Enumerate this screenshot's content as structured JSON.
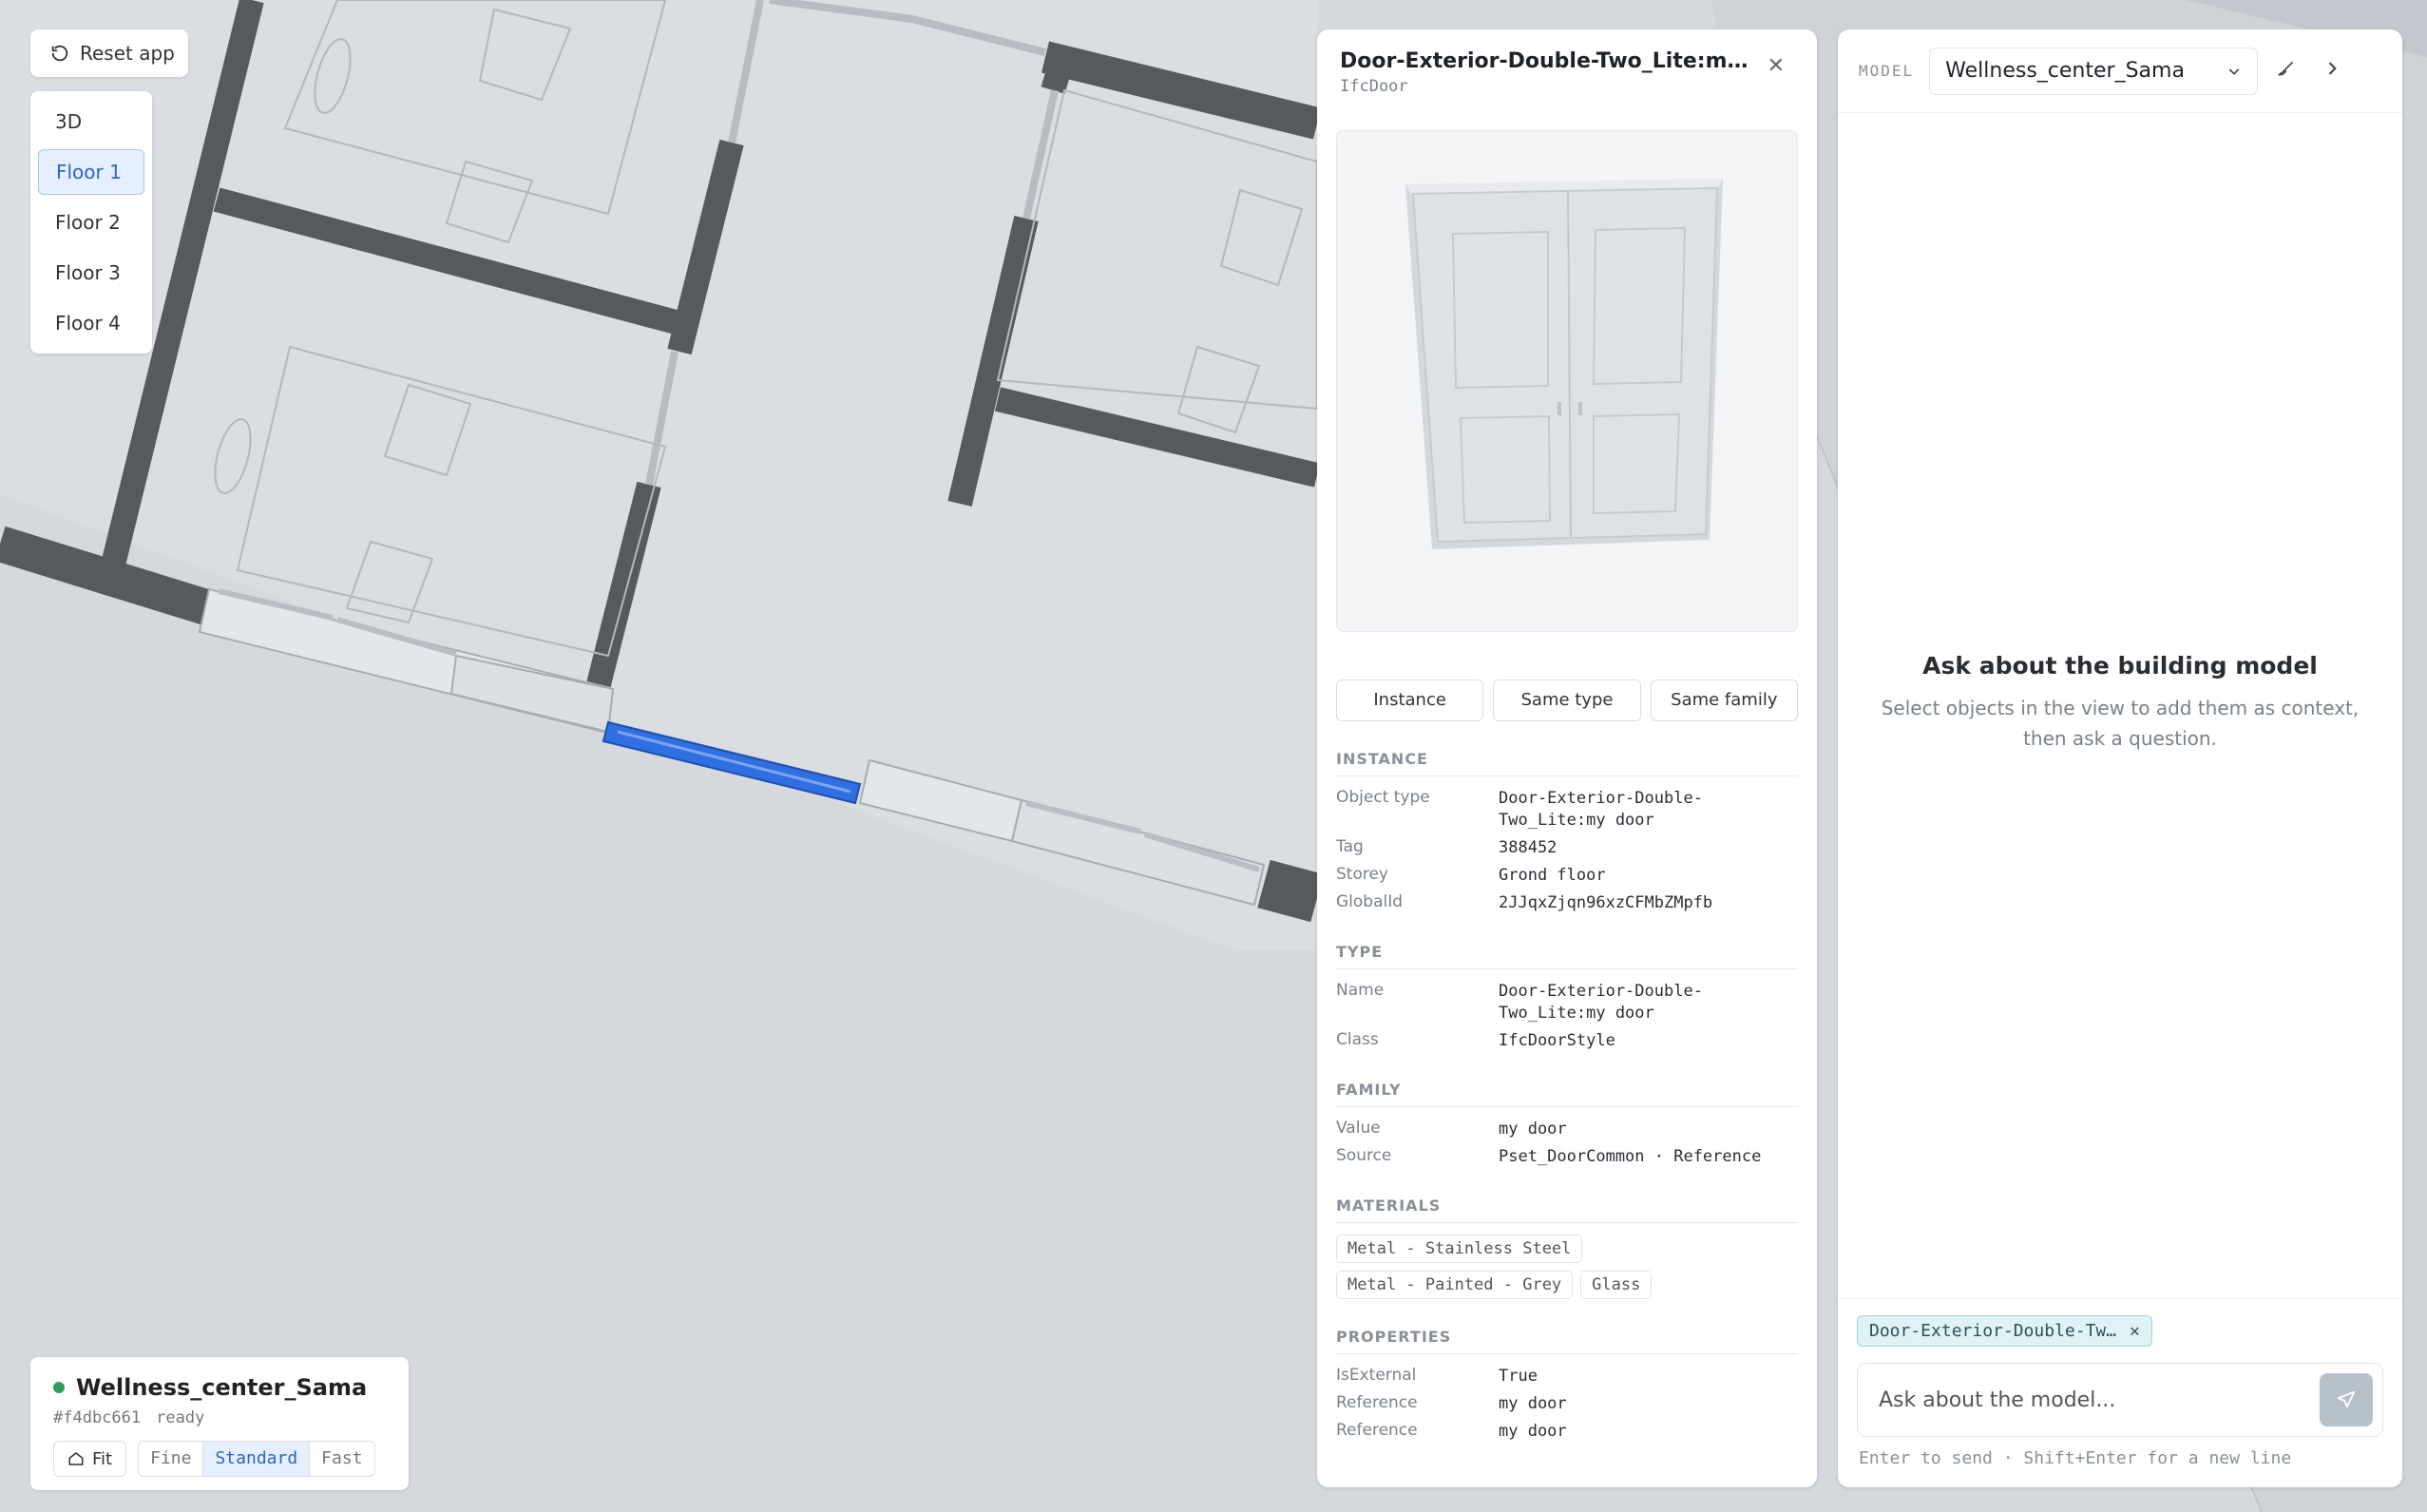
{
  "toolbar": {
    "reset_label": "Reset app"
  },
  "floors": {
    "items": [
      "3D",
      "Floor 1",
      "Floor 2",
      "Floor 3",
      "Floor 4"
    ],
    "active": "Floor 1"
  },
  "status": {
    "model_name": "Wellness_center_Sama",
    "hash": "#f4dbc661",
    "state": "ready",
    "fit_label": "Fit",
    "quality_options": [
      "Fine",
      "Standard",
      "Fast"
    ],
    "quality_active": "Standard"
  },
  "properties": {
    "title": "Door-Exterior-Double-Two_Lite:my door",
    "ifc_class": "IfcDoor",
    "selection_tabs": [
      "Instance",
      "Same type",
      "Same family"
    ],
    "instance": {
      "heading": "INSTANCE",
      "object_type_key": "Object type",
      "object_type": "Door-Exterior-Double-Two_Lite:my door",
      "tag_key": "Tag",
      "tag": "388452",
      "storey_key": "Storey",
      "storey": "Grond floor",
      "globalid_key": "GlobalId",
      "globalid": "2JJqxZjqn96xzCFMbZMpfb"
    },
    "type": {
      "heading": "TYPE",
      "name_key": "Name",
      "name": "Door-Exterior-Double-Two_Lite:my door",
      "class_key": "Class",
      "class": "IfcDoorStyle"
    },
    "family": {
      "heading": "FAMILY",
      "value_key": "Value",
      "value": "my door",
      "source_key": "Source",
      "source": "Pset_DoorCommon · Reference"
    },
    "materials": {
      "heading": "MATERIALS",
      "items": [
        "Metal - Stainless Steel",
        "Metal - Painted - Grey",
        "Glass"
      ]
    },
    "props": {
      "heading": "PROPERTIES",
      "rows": [
        {
          "k": "IsExternal",
          "v": "True"
        },
        {
          "k": "Reference",
          "v": "my door"
        },
        {
          "k": "Reference",
          "v": "my door"
        }
      ]
    }
  },
  "assistant": {
    "model_label": "MODEL",
    "model_value": "Wellness_center_Sama",
    "empty_title": "Ask about the building model",
    "empty_sub": "Select objects in the view to add them as context, then ask a question.",
    "context_chip": "Door-Exterior-Double-Two_Lite:my door",
    "placeholder": "Ask about the model...",
    "hint": "Enter to send · Shift+Enter for a new line"
  },
  "colors": {
    "wall": "#56595d",
    "floor": "#d5d9de",
    "selection": "#2f6fe0",
    "accent": "#2a64c8"
  }
}
